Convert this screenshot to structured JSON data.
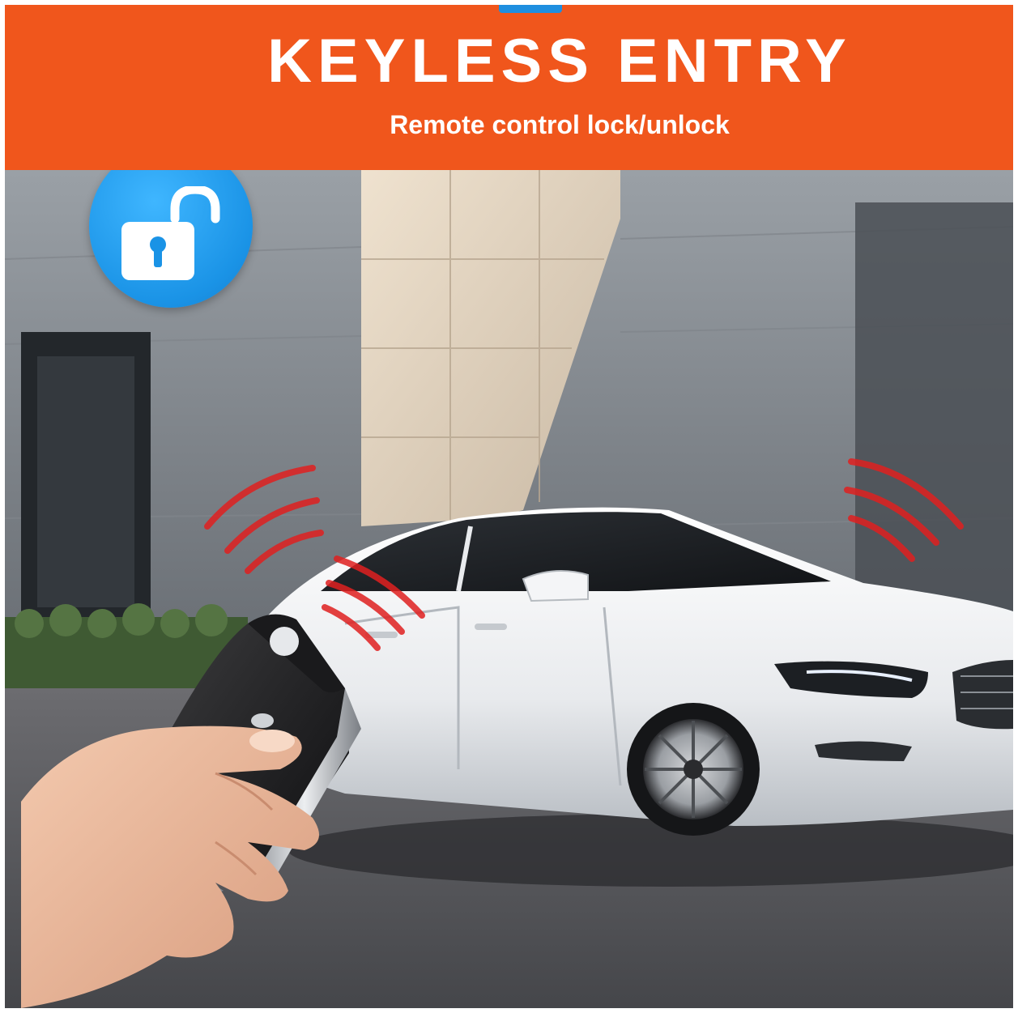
{
  "banner": {
    "title": "KEYLESS ENTRY",
    "subtitle": "Remote control lock/unlock",
    "background_color": "#f0561c",
    "text_color": "#ffffff"
  },
  "badge": {
    "icon": "unlock-padlock-icon",
    "color": "#1a93e6"
  },
  "scene": {
    "signal_color": "#e02020"
  }
}
